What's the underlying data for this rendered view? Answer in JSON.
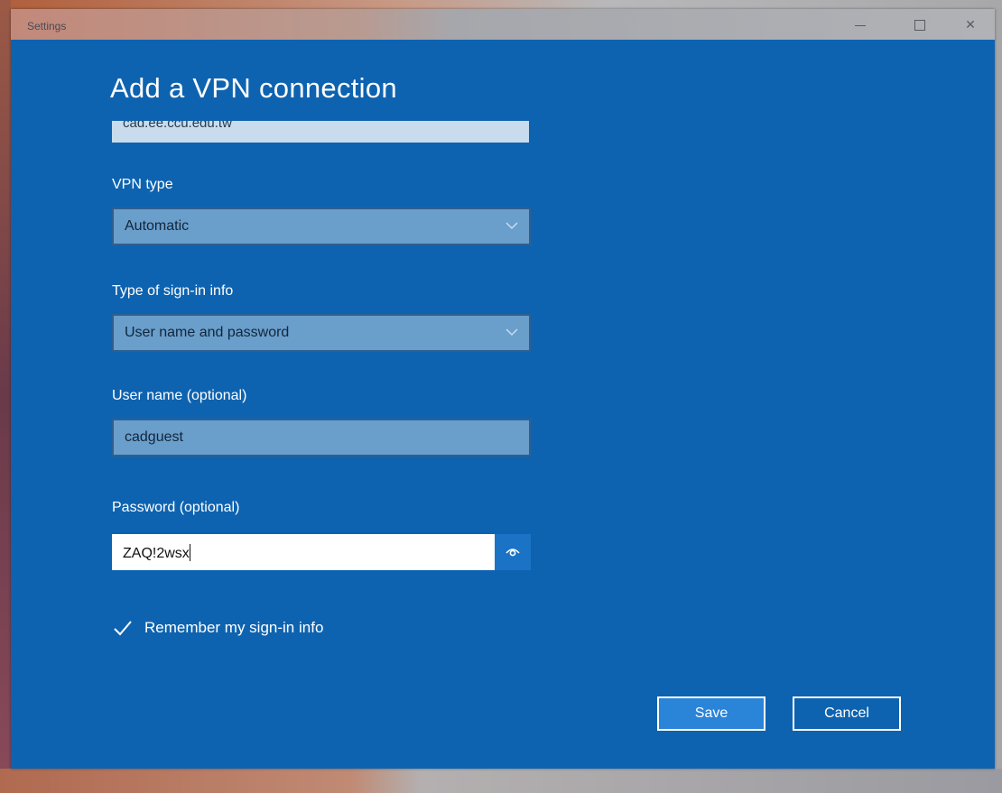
{
  "window": {
    "title": "Settings",
    "controls": [
      "minimize",
      "maximize",
      "close"
    ]
  },
  "page": {
    "heading": "Add a VPN connection"
  },
  "form": {
    "server_value": "cad.ee.ccu.edu.tw",
    "vpn_type": {
      "label": "VPN type",
      "selected": "Automatic"
    },
    "signin_type": {
      "label": "Type of sign-in info",
      "selected": "User name and password"
    },
    "username": {
      "label": "User name (optional)",
      "value": "cadguest"
    },
    "password": {
      "label": "Password (optional)",
      "value": "ZAQ!2wsx"
    },
    "remember": {
      "label": "Remember my sign-in info",
      "checked": true
    }
  },
  "actions": {
    "save_label": "Save",
    "cancel_label": "Cancel"
  },
  "colors": {
    "accent": "#0e63b0",
    "field": "#6a9ecb",
    "save_button": "#2a84d8"
  },
  "icons": [
    "chevron-down-icon",
    "eye-icon",
    "checkmark-icon"
  ]
}
